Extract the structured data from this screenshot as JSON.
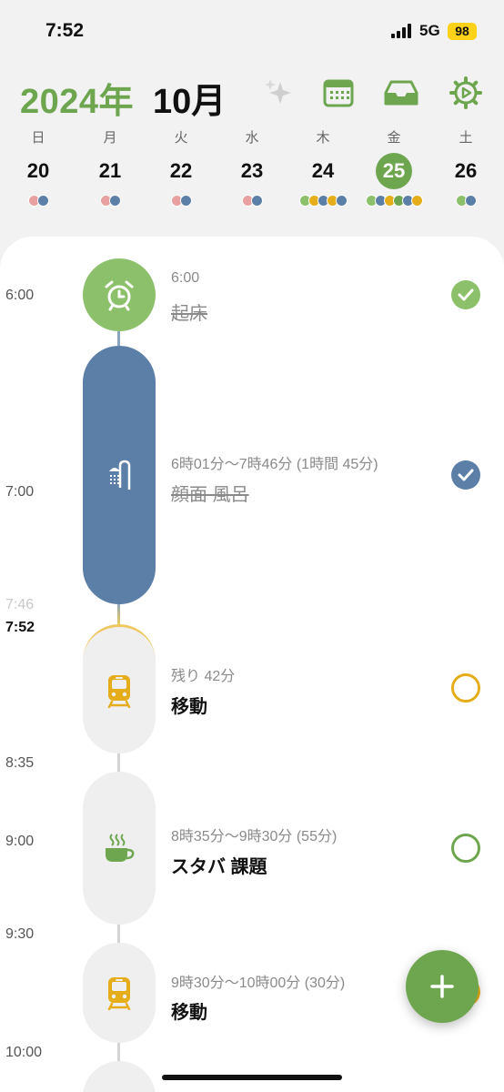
{
  "status": {
    "time": "7:52",
    "network": "5G",
    "battery": "98"
  },
  "header": {
    "year": "2024年",
    "month": "10月",
    "icons": [
      "sparkles-icon",
      "calendar-icon",
      "inbox-icon",
      "settings-icon"
    ]
  },
  "week": [
    {
      "name": "日",
      "num": "20",
      "dots": [
        "#e8a0a0",
        "#5b7fa6"
      ]
    },
    {
      "name": "月",
      "num": "21",
      "dots": [
        "#e8a0a0",
        "#5b7fa6"
      ]
    },
    {
      "name": "火",
      "num": "22",
      "dots": [
        "#e8a0a0",
        "#5b7fa6"
      ]
    },
    {
      "name": "水",
      "num": "23",
      "dots": [
        "#e8a0a0",
        "#5b7fa6"
      ]
    },
    {
      "name": "木",
      "num": "24",
      "dots": [
        "#8cc06a",
        "#e6ad1a",
        "#5b7fa6",
        "#e6ad1a",
        "#5b7fa6"
      ]
    },
    {
      "name": "金",
      "num": "25",
      "selected": true,
      "dots": [
        "#8cc06a",
        "#5b7fa6",
        "#e6ad1a",
        "#6da64f",
        "#5b7fa6",
        "#e6ad1a"
      ]
    },
    {
      "name": "土",
      "num": "26",
      "dots": [
        "#8cc06a",
        "#5b7fa6"
      ]
    }
  ],
  "timeline": {
    "labels": [
      "6:00",
      "7:00",
      "7:46",
      "7:52",
      "8:35",
      "9:00",
      "9:30",
      "10:00"
    ],
    "events": [
      {
        "subtitle": "6:00",
        "title": "起床",
        "icon": "alarm-clock-icon",
        "done": true
      },
      {
        "subtitle": "6時01分〜7時46分 (1時間 45分)",
        "title": "顔面 風呂",
        "icon": "shower-icon",
        "done": true
      },
      {
        "subtitle": "残り 42分",
        "title": "移動",
        "icon": "train-icon",
        "done": false
      },
      {
        "subtitle": "8時35分〜9時30分 (55分)",
        "title": "スタバ 課題",
        "icon": "coffee-icon",
        "done": false
      },
      {
        "subtitle": "9時30分〜10時00分 (30分)",
        "title": "移動",
        "icon": "train-icon",
        "done": false
      }
    ]
  },
  "colors": {
    "green": "#6da64f",
    "blue": "#5b7fa6",
    "yellow": "#e6ad1a"
  },
  "fab_icon": "plus-icon"
}
